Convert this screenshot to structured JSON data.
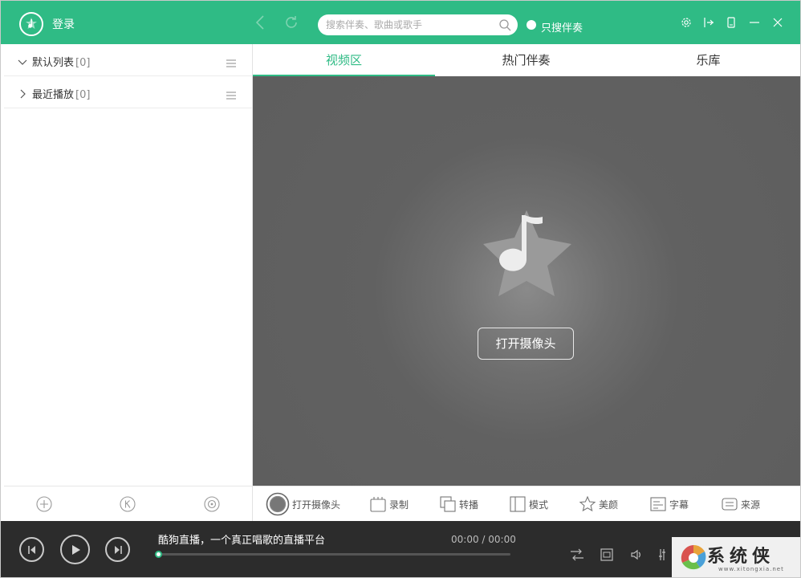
{
  "header": {
    "login_label": "登录",
    "search_placeholder": "搜索伴奏、歌曲或歌手",
    "only_accompaniment_label": "只搜伴奏"
  },
  "sidebar": {
    "playlists": [
      {
        "name": "默认列表",
        "count": "[0]",
        "expanded": true
      },
      {
        "name": "最近播放",
        "count": "[0]",
        "expanded": false
      }
    ]
  },
  "tabs": [
    {
      "label": "视频区",
      "active": true
    },
    {
      "label": "热门伴奏",
      "active": false
    },
    {
      "label": "乐库",
      "active": false
    }
  ],
  "video": {
    "open_camera_button": "打开摄像头"
  },
  "toolbar": {
    "items": [
      {
        "label": "打开摄像头",
        "icon": "camera-icon"
      },
      {
        "label": "录制",
        "icon": "record-icon"
      },
      {
        "label": "转播",
        "icon": "rebroadcast-icon"
      },
      {
        "label": "模式",
        "icon": "mode-icon"
      },
      {
        "label": "美颜",
        "icon": "beauty-icon"
      },
      {
        "label": "字幕",
        "icon": "subtitle-icon"
      },
      {
        "label": "来源",
        "icon": "source-icon"
      }
    ]
  },
  "player": {
    "title": "酷狗直播，一个真正唱歌的直播平台",
    "time": "00:00 / 00:00",
    "progress": 0
  },
  "watermark": {
    "text": "系统侠",
    "url": "www.xitongxia.net"
  },
  "colors": {
    "accent": "#2fbb85",
    "video_bg": "#5e5e5e",
    "player_bg": "#2c2c2c"
  }
}
